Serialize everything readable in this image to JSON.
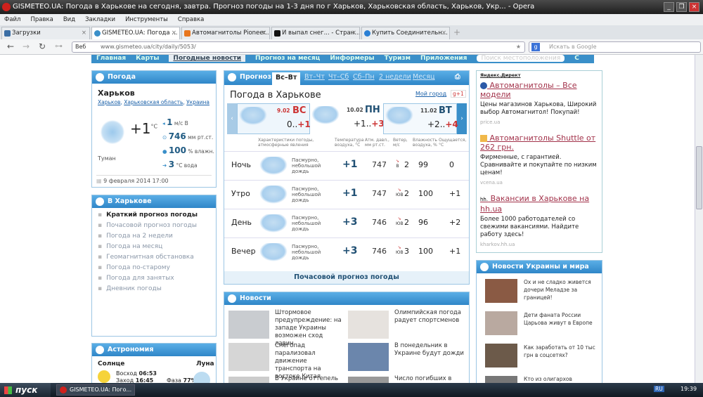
{
  "window": {
    "title": "GISMETEO.UA: Погода в Харькове на сегодня, завтра. Прогноз погоды на 1-3 дня по г Харьков, Харьковская область, Харьков, Укр... - Opera"
  },
  "menu": [
    "Файл",
    "Правка",
    "Вид",
    "Закладки",
    "Инструменты",
    "Справка"
  ],
  "tabs": [
    "Загрузки",
    "GISMETEO.UA: Погода ...",
    "Автомагнитолы Pioneer...",
    "И выпал снег... - Стран...",
    "Купить Соединительн..."
  ],
  "address": {
    "label": "Веб",
    "url": "www.gismeteo.ua/city/daily/5053/",
    "search_placeholder": "Искать в Google"
  },
  "nav": [
    "Главная",
    "Карты",
    "Погодные новости",
    "Прогноз на месяц",
    "Информеры",
    "Туризм",
    "Приложения",
    "Поиск местоположения",
    "С"
  ],
  "current": {
    "header": "Погода",
    "city": "Харьков",
    "breadcrumb": [
      "Харьков",
      "Харьковская область",
      "Украина"
    ],
    "temp": "+1",
    "temp_unit": "°C",
    "condition": "Туман",
    "wind": "1",
    "wind_unit": "м/с",
    "wind_dir": "В",
    "pressure": "746",
    "pressure_unit": "мм рт.ст.",
    "humidity": "100",
    "humidity_unit": "% влажн.",
    "water": "3",
    "water_unit": "°C вода",
    "date": "9 февраля 2014 17:00"
  },
  "city_menu": {
    "header": "В Харькове",
    "items": [
      "Краткий прогноз погоды",
      "Почасовой прогноз погоды",
      "Погода на 2 недели",
      "Погода на месяц",
      "Геомагнитная обстановка",
      "Погода по-старому",
      "Погода для занятых",
      "Дневник погоды"
    ]
  },
  "astro": {
    "header": "Астрономия",
    "sun": "Солнце",
    "moon": "Луна",
    "sunrise_label": "Восход",
    "sunrise": "06:53",
    "sunset_label": "Заход",
    "sunset": "16:45",
    "phase_label": "Фаза",
    "phase": "77%"
  },
  "forecast": {
    "header": "Прогноз",
    "tabs": [
      "Вс–Вт",
      "Вт–Чт",
      "Чт–Сб",
      "Сб–Пн",
      "2 недели",
      "Месяц"
    ],
    "title": "Погода в Харькове",
    "my_city": "Мой город",
    "gplus": "g+1",
    "days": [
      {
        "date": "9.02",
        "dow": "ВС",
        "min": "0..",
        "max": "+1"
      },
      {
        "date": "10.02",
        "dow": "ПН",
        "min": "+1..",
        "max": "+3"
      },
      {
        "date": "11.02",
        "dow": "ВТ",
        "min": "+2..",
        "max": "+4"
      }
    ],
    "columns": [
      "Характеристики погоды, атмосферные явления",
      "Температура воздуха, °C",
      "Атм. давл., мм рт.ст.",
      "Ветер, м/с",
      "Влажность воздуха, %",
      "Ощущается, °C"
    ],
    "rows": [
      {
        "period": "Ночь",
        "desc": "Пасмурно, небольшой дождь",
        "temp": "+1",
        "pressure": "747",
        "wind_dir": "В",
        "wind": "2",
        "humidity": "99",
        "feels": "0"
      },
      {
        "period": "Утро",
        "desc": "Пасмурно, небольшой дождь",
        "temp": "+1",
        "pressure": "747",
        "wind_dir": "ЮВ",
        "wind": "2",
        "humidity": "100",
        "feels": "+1"
      },
      {
        "period": "День",
        "desc": "Пасмурно, небольшой дождь",
        "temp": "+3",
        "pressure": "746",
        "wind_dir": "ЮВ",
        "wind": "2",
        "humidity": "96",
        "feels": "+2"
      },
      {
        "period": "Вечер",
        "desc": "Пасмурно, небольшой дождь",
        "temp": "+3",
        "pressure": "746",
        "wind_dir": "ЮВ",
        "wind": "3",
        "humidity": "100",
        "feels": "+1"
      }
    ],
    "hourly_link": "Почасовой прогноз погоды"
  },
  "news": {
    "header": "Новости",
    "items": [
      "Штормовое предупреждение: на западе Украины возможен сход лавин",
      "Олимпийская погода радует спортсменов",
      "Снегопад парализовал движение транспорта на востоке Китая",
      "В понедельник в Украине будут дожди",
      "В Украине оттепель",
      "Число погибших в"
    ]
  },
  "ads": {
    "header": "Яндекс.Директ",
    "items": [
      {
        "title": "Автомагнитолы – Все модели",
        "desc": "Цены магазинов Харькова, Широкий выбор Автомагнитол! Покупай!",
        "site": "price.ua"
      },
      {
        "title": "Автомагнитолы Shuttle от 262 грн.",
        "desc": "Фирменные, с гарантией. Сравнивайте и покупайте по низким ценам!",
        "site": "vcena.ua"
      },
      {
        "title": "Вакансии в Харькове на hh.ua",
        "desc": "Более 1000 работодателей со свежими вакансиями. Найдите работу здесь!",
        "site": "kharkov.hh.ua"
      }
    ]
  },
  "world_news": {
    "header": "Новости Украины и мира",
    "items": [
      "Ох и не сладко живется дочери Меладзе за границей!",
      "Дети фаната России Царьова живут в Европе",
      "Как заработать от 10 тыс грн в соцсетях?",
      "Кто из олигархов"
    ]
  },
  "taskbar": {
    "start": "пуск",
    "task": "GISMETEO.UA: Пого...",
    "lang": "RU",
    "time": "19:39"
  }
}
